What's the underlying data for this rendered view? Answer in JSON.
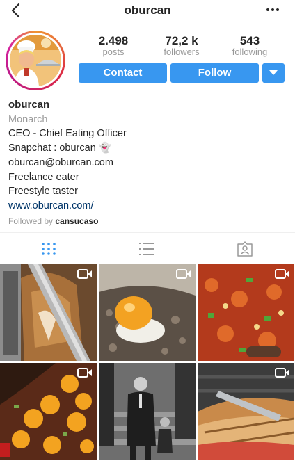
{
  "header": {
    "title": "oburcan"
  },
  "profile": {
    "stats": [
      {
        "value": "2.498",
        "label": "posts"
      },
      {
        "value": "72,2 k",
        "label": "followers"
      },
      {
        "value": "543",
        "label": "following"
      }
    ],
    "buttons": {
      "contact": "Contact",
      "follow": "Follow"
    }
  },
  "bio": {
    "name": "oburcan",
    "category": "Monarch",
    "lines": [
      "CEO - Chief Eating Officer",
      "Snapchat : oburcan 👻",
      "oburcan@oburcan.com",
      "Freelance eater",
      "Freestyle taster"
    ],
    "website": "www.oburcan.com/",
    "followed_by_prefix": "Followed by",
    "followed_by_user": "cansucaso"
  },
  "tabs": [
    {
      "icon": "grid-icon",
      "active": true
    },
    {
      "icon": "list-icon",
      "active": false
    },
    {
      "icon": "tagged-icon",
      "active": false
    }
  ],
  "grid_posts": [
    {
      "subject": "doner kebab",
      "is_video": true
    },
    {
      "subject": "egg on minced meat",
      "is_video": true
    },
    {
      "subject": "vegetable stew",
      "is_video": true
    },
    {
      "subject": "eggs in pan",
      "is_video": true
    },
    {
      "subject": "historic black and white photo",
      "is_video": false
    },
    {
      "subject": "pressed sandwich",
      "is_video": true
    }
  ],
  "colors": {
    "accent": "#3897f0",
    "link": "#003569",
    "muted": "#999999"
  }
}
